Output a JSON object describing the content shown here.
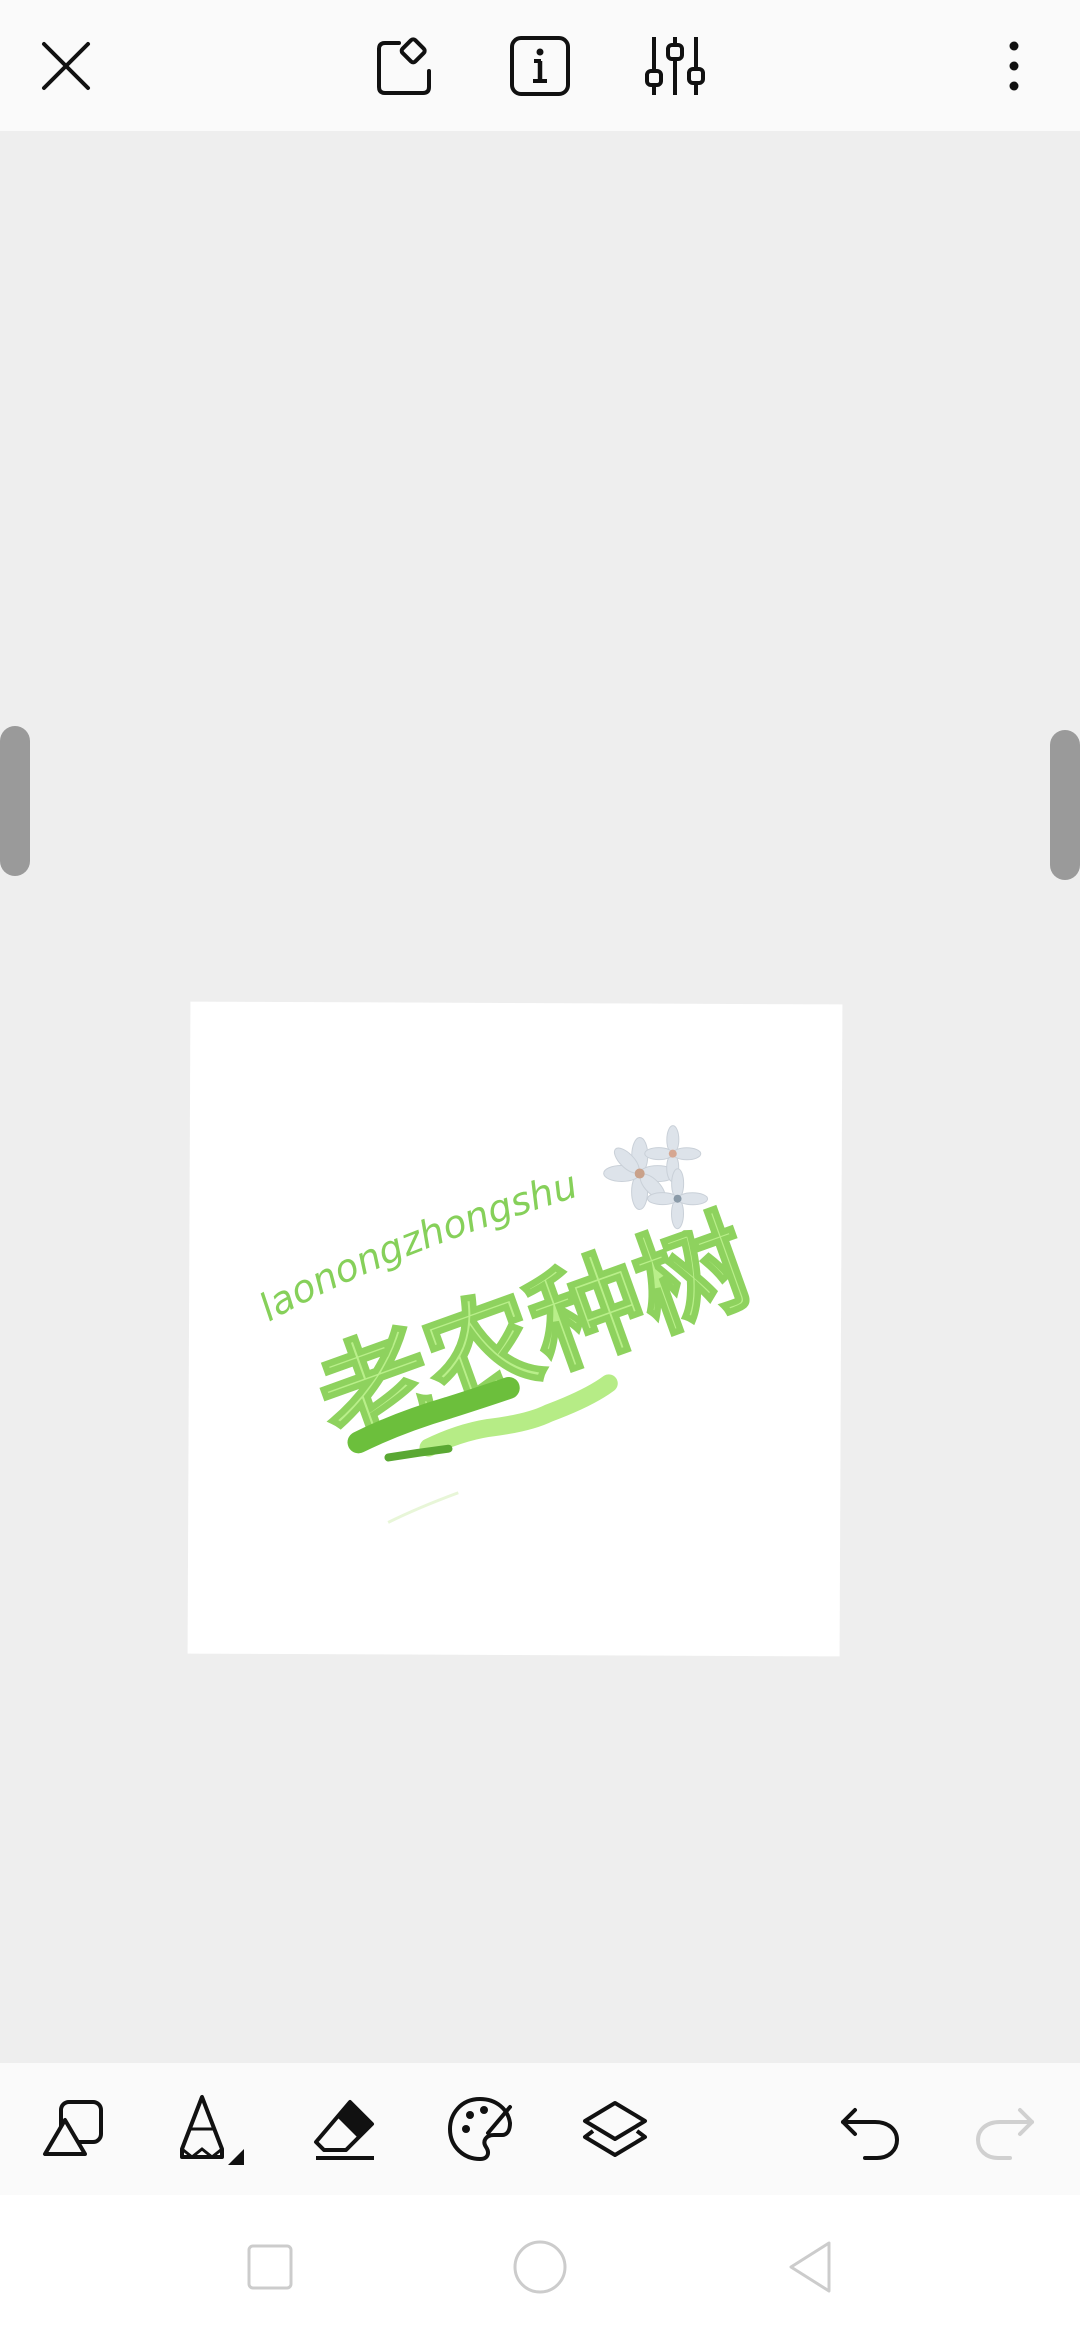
{
  "top_toolbar": {
    "close_icon": "close-icon",
    "selection_icon": "selection-tool-icon",
    "info_icon": "info-icon",
    "adjust_icon": "sliders-icon",
    "more_icon": "more-vertical-icon"
  },
  "artwork": {
    "pinyin_text": "laonongzhongshu",
    "title_text": "老农种树",
    "colors": {
      "light_green": "#b9ef8a",
      "green": "#7fcf4b",
      "dark_green": "#5fae36",
      "flower": "#dde3ea"
    }
  },
  "bottom_toolbar": {
    "shapes_icon": "shapes-icon",
    "pencil_icon": "pencil-icon",
    "eraser_icon": "eraser-icon",
    "palette_icon": "palette-icon",
    "layers_icon": "layers-icon",
    "undo_icon": "undo-icon",
    "redo_icon": "redo-icon",
    "redo_enabled": false
  },
  "system_nav": {
    "recents_icon": "square-icon",
    "home_icon": "circle-icon",
    "back_icon": "triangle-back-icon"
  }
}
